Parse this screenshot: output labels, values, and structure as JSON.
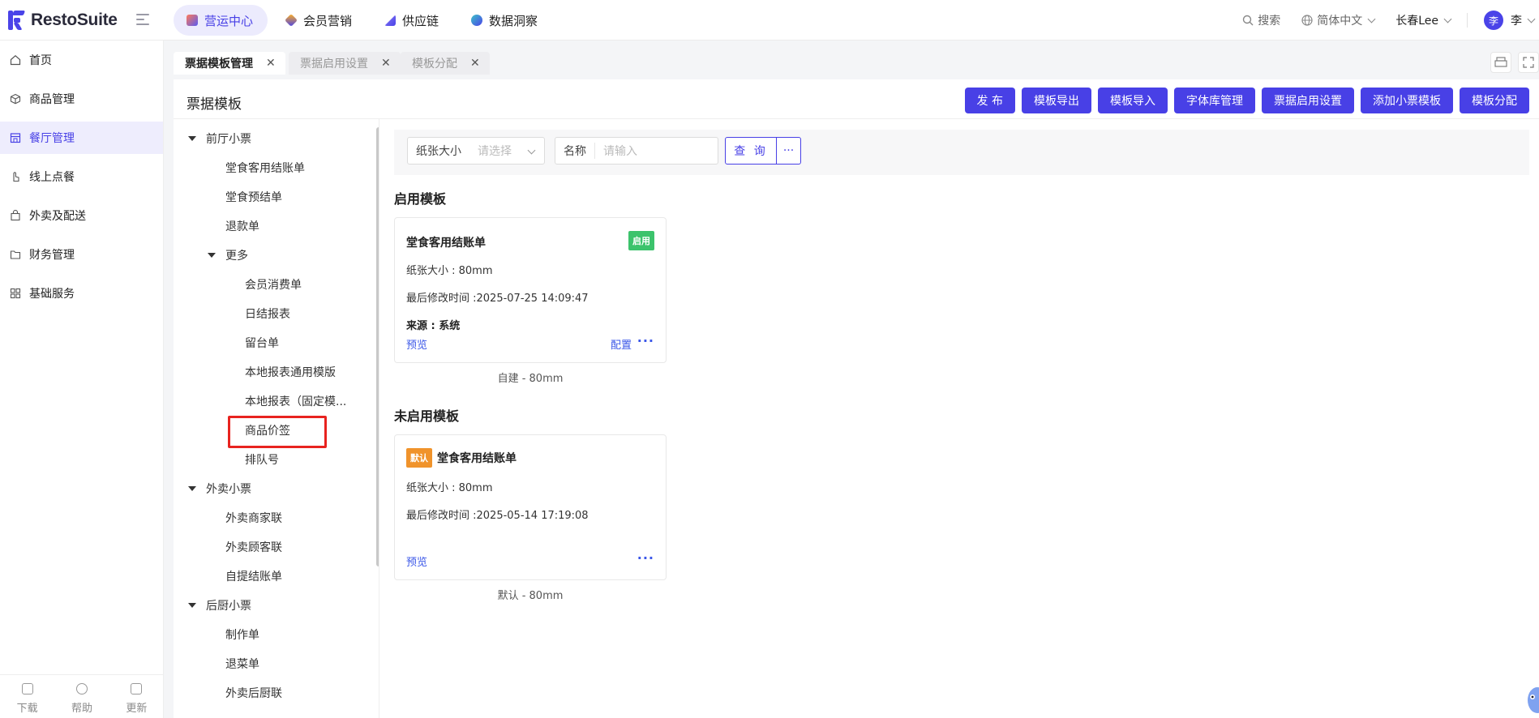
{
  "brand": {
    "name": "RestoSuite",
    "color": "#4a43e8"
  },
  "topnav": [
    {
      "label": "营运中心",
      "active": true,
      "icon": "operations-icon"
    },
    {
      "label": "会员营销",
      "active": false,
      "icon": "marketing-icon"
    },
    {
      "label": "供应链",
      "active": false,
      "icon": "supply-chain-icon"
    },
    {
      "label": "数据洞察",
      "active": false,
      "icon": "insights-icon"
    }
  ],
  "header_right": {
    "search": "搜索",
    "language": "简体中文",
    "store": "长春Lee",
    "avatar_char": "李",
    "user": "李"
  },
  "sidebar": {
    "items": [
      {
        "label": "首页",
        "active": false
      },
      {
        "label": "商品管理",
        "active": false
      },
      {
        "label": "餐厅管理",
        "active": true
      },
      {
        "label": "线上点餐",
        "active": false
      },
      {
        "label": "外卖及配送",
        "active": false
      },
      {
        "label": "财务管理",
        "active": false
      },
      {
        "label": "基础服务",
        "active": false
      }
    ],
    "bottom": [
      {
        "label": "下载"
      },
      {
        "label": "帮助"
      },
      {
        "label": "更新"
      }
    ]
  },
  "tabs": [
    {
      "label": "票据模板管理",
      "active": true
    },
    {
      "label": "票据启用设置",
      "active": false
    },
    {
      "label": "模板分配",
      "active": false
    }
  ],
  "page": {
    "title": "票据模板",
    "actions": [
      "发 布",
      "模板导出",
      "模板导入",
      "字体库管理",
      "票据启用设置",
      "添加小票模板",
      "模板分配"
    ]
  },
  "tree": [
    {
      "label": "前厅小票",
      "level": 0,
      "expanded": true
    },
    {
      "label": "堂食客用结账单",
      "level": 1
    },
    {
      "label": "堂食预结单",
      "level": 1
    },
    {
      "label": "退款单",
      "level": 1
    },
    {
      "label": "更多",
      "level": 1,
      "expanded": true
    },
    {
      "label": "会员消费单",
      "level": 2
    },
    {
      "label": "日结报表",
      "level": 2
    },
    {
      "label": "留台单",
      "level": 2
    },
    {
      "label": "本地报表通用模版",
      "level": 2
    },
    {
      "label": "本地报表（固定模...",
      "level": 2
    },
    {
      "label": "商品价签",
      "level": 2,
      "highlighted": true
    },
    {
      "label": "排队号",
      "level": 2
    },
    {
      "label": "外卖小票",
      "level": 0,
      "expanded": true
    },
    {
      "label": "外卖商家联",
      "level": 1
    },
    {
      "label": "外卖顾客联",
      "level": 1
    },
    {
      "label": "自提结账单",
      "level": 1
    },
    {
      "label": "后厨小票",
      "level": 0,
      "expanded": true
    },
    {
      "label": "制作单",
      "level": 1
    },
    {
      "label": "退菜单",
      "level": 1
    },
    {
      "label": "外卖后厨联",
      "level": 1
    }
  ],
  "filter": {
    "paper_label": "纸张大小",
    "paper_placeholder": "请选择",
    "name_label": "名称",
    "name_placeholder": "请输入",
    "query_label": "查 询",
    "more_label": "···"
  },
  "enabled_section": {
    "title": "启用模板",
    "card": {
      "title": "堂食客用结账单",
      "badge": "启用",
      "paper": "纸张大小 : 80mm",
      "modified": "最后修改时间 :2025-07-25 14:09:47",
      "source": "来源 : 系统",
      "preview": "预览",
      "config": "配置",
      "dots": "···",
      "caption": "自建 - 80mm"
    }
  },
  "disabled_section": {
    "title": "未启用模板",
    "card": {
      "badge": "默认",
      "title": "堂食客用结账单",
      "paper": "纸张大小 : 80mm",
      "modified": "最后修改时间 :2025-05-14 17:19:08",
      "preview": "预览",
      "dots": "···",
      "caption": "默认 - 80mm"
    }
  }
}
